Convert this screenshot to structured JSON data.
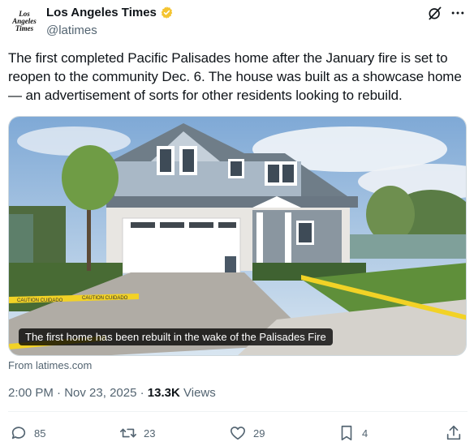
{
  "author": {
    "name": "Los Angeles Times",
    "handle": "@latimes",
    "avatar_lines": [
      "Los",
      "Angeles",
      "Times"
    ]
  },
  "tweet": {
    "text": "The first completed Pacific Palisades home after the January fire is set to reopen to the community Dec. 6. The house was built as a showcase home — an advertisement of sorts for other residents looking to rebuild."
  },
  "media": {
    "caption": "The first home has been rebuilt in the wake of the Palisades Fire",
    "tape_text": "CAUTION CUIDADO"
  },
  "link_source": "From latimes.com",
  "meta": {
    "time": "2:00 PM",
    "date": "Nov 23, 2025",
    "views_count": "13.3K",
    "views_label": "Views"
  },
  "actions": {
    "replies": "85",
    "reposts": "23",
    "likes": "29",
    "bookmarks": "4"
  },
  "icons": [
    "grok-icon",
    "more-icon",
    "verified-badge-icon",
    "reply-icon",
    "repost-icon",
    "like-icon",
    "bookmark-icon",
    "share-icon"
  ],
  "colors": {
    "verified": "#f4c430",
    "text": "#0f1419",
    "secondary": "#536471"
  }
}
